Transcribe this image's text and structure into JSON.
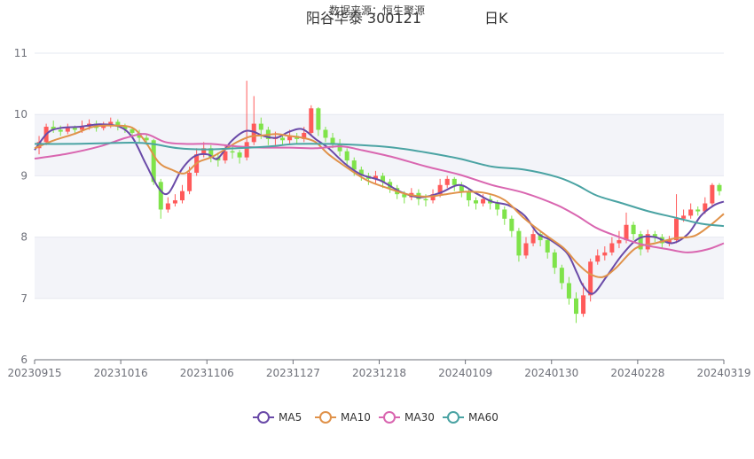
{
  "chart_data": {
    "type": "candlestick",
    "title": "阳谷华泰 300121",
    "period_label": "日K",
    "subtitle": "数据来源：恒生聚源",
    "ylim": [
      6,
      11
    ],
    "y_ticks": [
      "6",
      "7",
      "8",
      "9",
      "10",
      "11"
    ],
    "x_ticks": [
      "20230915",
      "20231016",
      "20231106",
      "20231127",
      "20231218",
      "20240109",
      "20240130",
      "20240228",
      "20240319"
    ],
    "legend_position": "bottom-center",
    "grid": "horizontal bands",
    "colors": {
      "up": "#ff5a5a",
      "down": "#7fe34a",
      "MA5": "#6a4aa8",
      "MA10": "#e0924a",
      "MA30": "#d966b0",
      "MA60": "#4aa3a3",
      "band": "#f3f4f9",
      "axis": "#6e7079"
    },
    "series": [
      {
        "name": "MA5",
        "key": "MA5",
        "points": [
          [
            0,
            9.42
          ],
          [
            4,
            9.7
          ],
          [
            8,
            9.78
          ],
          [
            14,
            9.8
          ],
          [
            20,
            9.84
          ],
          [
            26,
            9.8
          ],
          [
            30,
            9.62
          ],
          [
            34,
            9.2
          ],
          [
            38,
            8.8
          ],
          [
            41,
            8.72
          ],
          [
            45,
            9.1
          ],
          [
            49,
            9.32
          ],
          [
            53,
            9.35
          ],
          [
            56,
            9.28
          ],
          [
            60,
            9.55
          ],
          [
            64,
            9.72
          ],
          [
            67,
            9.72
          ],
          [
            70,
            9.65
          ],
          [
            74,
            9.62
          ],
          [
            78,
            9.72
          ],
          [
            82,
            9.76
          ],
          [
            86,
            9.6
          ],
          [
            90,
            9.45
          ],
          [
            95,
            9.2
          ],
          [
            100,
            9.02
          ],
          [
            106,
            8.92
          ],
          [
            112,
            8.74
          ],
          [
            118,
            8.65
          ],
          [
            124,
            8.72
          ],
          [
            130,
            8.85
          ],
          [
            135,
            8.72
          ],
          [
            140,
            8.58
          ],
          [
            145,
            8.52
          ],
          [
            150,
            8.35
          ],
          [
            154,
            8.06
          ],
          [
            158,
            7.95
          ],
          [
            163,
            7.74
          ],
          [
            166,
            7.42
          ],
          [
            168,
            7.2
          ],
          [
            171,
            7.08
          ],
          [
            175,
            7.35
          ],
          [
            180,
            7.72
          ],
          [
            185,
            7.98
          ],
          [
            190,
            8.0
          ],
          [
            195,
            7.9
          ],
          [
            200,
            8.05
          ],
          [
            204,
            8.35
          ],
          [
            208,
            8.52
          ],
          [
            211,
            8.58
          ]
        ]
      },
      {
        "name": "MA10",
        "key": "MA10",
        "points": [
          [
            0,
            9.45
          ],
          [
            6,
            9.58
          ],
          [
            12,
            9.68
          ],
          [
            18,
            9.8
          ],
          [
            24,
            9.82
          ],
          [
            30,
            9.78
          ],
          [
            34,
            9.55
          ],
          [
            38,
            9.22
          ],
          [
            42,
            9.1
          ],
          [
            46,
            9.04
          ],
          [
            50,
            9.22
          ],
          [
            54,
            9.3
          ],
          [
            58,
            9.42
          ],
          [
            62,
            9.55
          ],
          [
            66,
            9.64
          ],
          [
            70,
            9.66
          ],
          [
            74,
            9.68
          ],
          [
            78,
            9.65
          ],
          [
            82,
            9.62
          ],
          [
            86,
            9.55
          ],
          [
            90,
            9.35
          ],
          [
            96,
            9.12
          ],
          [
            102,
            8.92
          ],
          [
            108,
            8.8
          ],
          [
            114,
            8.7
          ],
          [
            120,
            8.66
          ],
          [
            126,
            8.7
          ],
          [
            132,
            8.74
          ],
          [
            138,
            8.72
          ],
          [
            144,
            8.6
          ],
          [
            150,
            8.3
          ],
          [
            156,
            8.05
          ],
          [
            162,
            7.82
          ],
          [
            166,
            7.58
          ],
          [
            170,
            7.4
          ],
          [
            174,
            7.35
          ],
          [
            178,
            7.5
          ],
          [
            184,
            7.82
          ],
          [
            190,
            7.9
          ],
          [
            196,
            7.98
          ],
          [
            202,
            8.02
          ],
          [
            207,
            8.2
          ],
          [
            211,
            8.38
          ]
        ]
      },
      {
        "name": "MA30",
        "key": "MA30",
        "points": [
          [
            0,
            9.28
          ],
          [
            10,
            9.36
          ],
          [
            20,
            9.48
          ],
          [
            28,
            9.62
          ],
          [
            34,
            9.68
          ],
          [
            40,
            9.55
          ],
          [
            46,
            9.52
          ],
          [
            54,
            9.52
          ],
          [
            62,
            9.48
          ],
          [
            70,
            9.46
          ],
          [
            78,
            9.46
          ],
          [
            86,
            9.45
          ],
          [
            94,
            9.48
          ],
          [
            100,
            9.42
          ],
          [
            110,
            9.3
          ],
          [
            120,
            9.15
          ],
          [
            130,
            9.02
          ],
          [
            140,
            8.85
          ],
          [
            150,
            8.72
          ],
          [
            160,
            8.52
          ],
          [
            166,
            8.35
          ],
          [
            172,
            8.15
          ],
          [
            178,
            8.02
          ],
          [
            186,
            7.88
          ],
          [
            194,
            7.8
          ],
          [
            200,
            7.75
          ],
          [
            206,
            7.8
          ],
          [
            211,
            7.9
          ]
        ]
      },
      {
        "name": "MA60",
        "key": "MA60",
        "points": [
          [
            0,
            9.52
          ],
          [
            10,
            9.52
          ],
          [
            20,
            9.53
          ],
          [
            30,
            9.54
          ],
          [
            36,
            9.52
          ],
          [
            44,
            9.45
          ],
          [
            52,
            9.43
          ],
          [
            62,
            9.45
          ],
          [
            72,
            9.48
          ],
          [
            80,
            9.52
          ],
          [
            90,
            9.52
          ],
          [
            100,
            9.5
          ],
          [
            110,
            9.46
          ],
          [
            120,
            9.38
          ],
          [
            130,
            9.28
          ],
          [
            140,
            9.15
          ],
          [
            150,
            9.1
          ],
          [
            160,
            8.98
          ],
          [
            166,
            8.85
          ],
          [
            172,
            8.68
          ],
          [
            180,
            8.55
          ],
          [
            188,
            8.42
          ],
          [
            196,
            8.32
          ],
          [
            204,
            8.22
          ],
          [
            211,
            8.18
          ]
        ]
      }
    ],
    "candles": [
      [
        9.45,
        9.55,
        9.65,
        9.35
      ],
      [
        9.55,
        9.8,
        9.85,
        9.5
      ],
      [
        9.8,
        9.75,
        9.9,
        9.7
      ],
      [
        9.75,
        9.72,
        9.82,
        9.65
      ],
      [
        9.72,
        9.78,
        9.85,
        9.68
      ],
      [
        9.78,
        9.75,
        9.82,
        9.7
      ],
      [
        9.75,
        9.8,
        9.9,
        9.7
      ],
      [
        9.8,
        9.85,
        9.92,
        9.75
      ],
      [
        9.85,
        9.78,
        9.9,
        9.72
      ],
      [
        9.78,
        9.82,
        9.88,
        9.74
      ],
      [
        9.82,
        9.88,
        9.95,
        9.78
      ],
      [
        9.88,
        9.8,
        9.92,
        9.74
      ],
      [
        9.8,
        9.76,
        9.85,
        9.7
      ],
      [
        9.76,
        9.7,
        9.8,
        9.62
      ],
      [
        9.7,
        9.62,
        9.75,
        9.55
      ],
      [
        9.62,
        9.58,
        9.68,
        9.5
      ],
      [
        9.58,
        8.9,
        9.6,
        8.85
      ],
      [
        8.9,
        8.45,
        8.95,
        8.3
      ],
      [
        8.45,
        8.55,
        8.65,
        8.4
      ],
      [
        8.55,
        8.6,
        8.7,
        8.5
      ],
      [
        8.6,
        8.75,
        8.85,
        8.55
      ],
      [
        8.75,
        9.05,
        9.15,
        8.7
      ],
      [
        9.05,
        9.35,
        9.45,
        9.0
      ],
      [
        9.35,
        9.45,
        9.55,
        9.3
      ],
      [
        9.45,
        9.3,
        9.5,
        9.22
      ],
      [
        9.3,
        9.25,
        9.38,
        9.15
      ],
      [
        9.25,
        9.4,
        9.5,
        9.2
      ],
      [
        9.4,
        9.38,
        9.48,
        9.28
      ],
      [
        9.38,
        9.3,
        9.42,
        9.2
      ],
      [
        9.3,
        9.55,
        10.55,
        9.25
      ],
      [
        9.55,
        9.85,
        10.3,
        9.5
      ],
      [
        9.85,
        9.75,
        9.95,
        9.6
      ],
      [
        9.75,
        9.6,
        9.8,
        9.5
      ],
      [
        9.6,
        9.62,
        9.72,
        9.5
      ],
      [
        9.62,
        9.58,
        9.68,
        9.5
      ],
      [
        9.58,
        9.65,
        9.75,
        9.52
      ],
      [
        9.65,
        9.6,
        9.7,
        9.52
      ],
      [
        9.6,
        9.7,
        9.8,
        9.55
      ],
      [
        9.7,
        10.1,
        10.15,
        9.65
      ],
      [
        10.1,
        9.75,
        10.12,
        9.65
      ],
      [
        9.75,
        9.62,
        9.8,
        9.55
      ],
      [
        9.62,
        9.52,
        9.7,
        9.45
      ],
      [
        9.52,
        9.4,
        9.6,
        9.32
      ],
      [
        9.4,
        9.25,
        9.45,
        9.15
      ],
      [
        9.25,
        9.1,
        9.3,
        9.0
      ],
      [
        9.1,
        9.0,
        9.15,
        8.92
      ],
      [
        9.0,
        8.95,
        9.05,
        8.85
      ],
      [
        8.95,
        9.0,
        9.08,
        8.88
      ],
      [
        9.0,
        8.9,
        9.05,
        8.8
      ],
      [
        8.9,
        8.8,
        8.95,
        8.72
      ],
      [
        8.8,
        8.7,
        8.85,
        8.62
      ],
      [
        8.7,
        8.65,
        8.75,
        8.55
      ],
      [
        8.65,
        8.72,
        8.8,
        8.6
      ],
      [
        8.72,
        8.62,
        8.78,
        8.52
      ],
      [
        8.62,
        8.6,
        8.7,
        8.5
      ],
      [
        8.6,
        8.7,
        8.78,
        8.55
      ],
      [
        8.7,
        8.85,
        8.95,
        8.65
      ],
      [
        8.85,
        8.95,
        9.0,
        8.8
      ],
      [
        8.95,
        8.85,
        8.98,
        8.75
      ],
      [
        8.85,
        8.75,
        8.9,
        8.65
      ],
      [
        8.75,
        8.6,
        8.8,
        8.5
      ],
      [
        8.6,
        8.55,
        8.65,
        8.45
      ],
      [
        8.55,
        8.62,
        8.7,
        8.5
      ],
      [
        8.62,
        8.55,
        8.68,
        8.45
      ],
      [
        8.55,
        8.45,
        8.6,
        8.35
      ],
      [
        8.45,
        8.3,
        8.5,
        8.2
      ],
      [
        8.3,
        8.1,
        8.35,
        8.0
      ],
      [
        8.1,
        7.7,
        8.15,
        7.6
      ],
      [
        7.7,
        7.9,
        8.0,
        7.65
      ],
      [
        7.9,
        8.05,
        8.12,
        7.85
      ],
      [
        8.05,
        7.95,
        8.1,
        7.85
      ],
      [
        7.95,
        7.75,
        8.0,
        7.65
      ],
      [
        7.75,
        7.5,
        7.8,
        7.4
      ],
      [
        7.5,
        7.25,
        7.55,
        7.15
      ],
      [
        7.25,
        7.0,
        7.35,
        6.9
      ],
      [
        7.0,
        6.75,
        7.1,
        6.6
      ],
      [
        6.75,
        7.05,
        7.25,
        6.7
      ],
      [
        7.05,
        7.6,
        7.65,
        6.95
      ],
      [
        7.6,
        7.7,
        7.8,
        7.55
      ],
      [
        7.7,
        7.75,
        7.85,
        7.62
      ],
      [
        7.75,
        7.9,
        8.0,
        7.7
      ],
      [
        7.9,
        7.95,
        8.1,
        7.82
      ],
      [
        7.95,
        8.2,
        8.4,
        7.9
      ],
      [
        8.2,
        8.05,
        8.25,
        7.95
      ],
      [
        8.05,
        7.8,
        8.1,
        7.7
      ],
      [
        7.8,
        8.05,
        8.12,
        7.75
      ],
      [
        8.05,
        8.0,
        8.1,
        7.92
      ],
      [
        8.0,
        7.9,
        8.05,
        7.82
      ],
      [
        7.9,
        7.95,
        8.02,
        7.85
      ],
      [
        7.95,
        8.3,
        8.7,
        7.9
      ],
      [
        8.3,
        8.35,
        8.45,
        8.25
      ],
      [
        8.35,
        8.45,
        8.55,
        8.3
      ],
      [
        8.45,
        8.42,
        8.5,
        8.35
      ],
      [
        8.42,
        8.55,
        8.65,
        8.38
      ],
      [
        8.55,
        8.85,
        8.88,
        8.5
      ],
      [
        8.85,
        8.75,
        8.88,
        8.68
      ]
    ]
  },
  "legend": [
    {
      "label": "MA5",
      "color": "#6a4aa8"
    },
    {
      "label": "MA10",
      "color": "#e0924a"
    },
    {
      "label": "MA30",
      "color": "#d966b0"
    },
    {
      "label": "MA60",
      "color": "#4aa3a3"
    }
  ]
}
